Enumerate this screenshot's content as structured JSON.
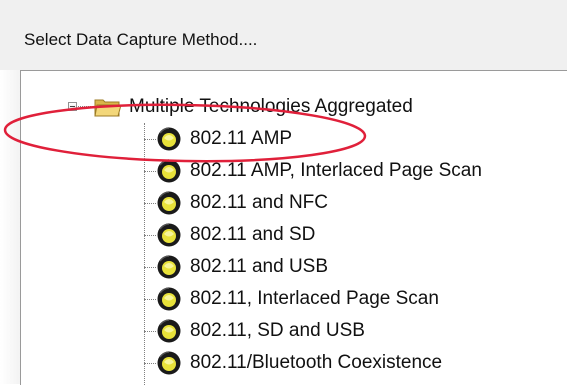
{
  "dialog": {
    "title": "Select Data Capture Method...."
  },
  "tree": {
    "group": {
      "label": "Multiple Technologies Aggregated",
      "icon": "folder-open-icon",
      "expanded": true
    },
    "items": [
      {
        "label": "802.11 AMP",
        "icon": "technology-globe-icon"
      },
      {
        "label": "802.11 AMP, Interlaced Page Scan",
        "icon": "technology-globe-icon"
      },
      {
        "label": "802.11 and NFC",
        "icon": "technology-globe-icon"
      },
      {
        "label": "802.11 and SD",
        "icon": "technology-globe-icon"
      },
      {
        "label": "802.11 and USB",
        "icon": "technology-globe-icon"
      },
      {
        "label": "802.11, Interlaced Page Scan",
        "icon": "technology-globe-icon"
      },
      {
        "label": "802.11, SD and USB",
        "icon": "technology-globe-icon"
      },
      {
        "label": "802.11/Bluetooth Coexistence",
        "icon": "technology-globe-icon"
      }
    ]
  },
  "annotation": {
    "color": "#e0203a",
    "target": "802.11 AMP"
  }
}
